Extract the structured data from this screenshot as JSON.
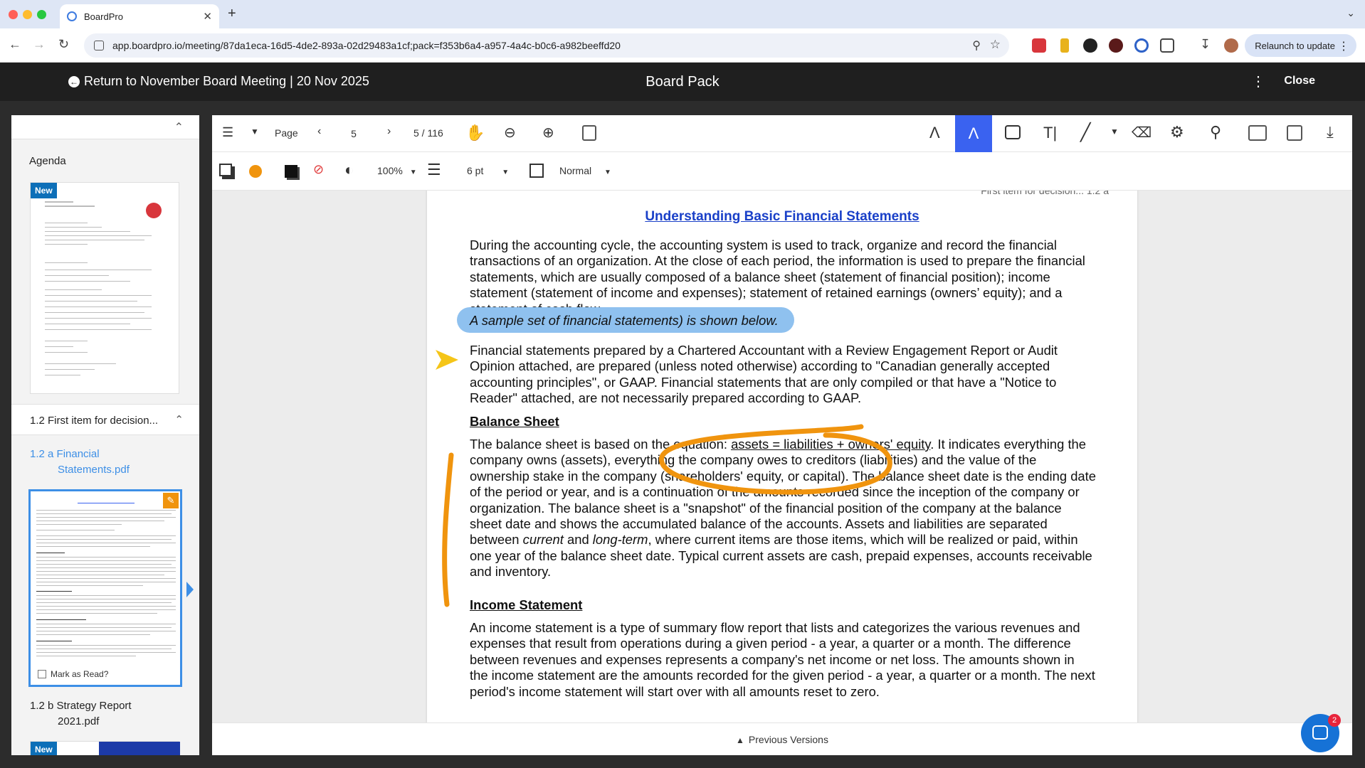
{
  "browser": {
    "tab_title": "BoardPro",
    "new_tab": "+",
    "tab_close": "✕",
    "tab_dropdown": "⌄",
    "url": "app.boardpro.io/meeting/87da1eca-16d5-4de2-893a-02d29483a1cf;pack=f353b6a4-a957-4a4c-b0c6-a982beeffd20",
    "relaunch_label": "Relaunch to update"
  },
  "header": {
    "back_label": "Return to November Board Meeting | 20 Nov 2025",
    "title": "Board Pack",
    "close_label": "Close"
  },
  "sidebar": {
    "agenda_label": "Agenda",
    "new_badge": "New",
    "section_label": "1.2 First item for decision...",
    "files": [
      {
        "label_line1": "1.2 a Financial",
        "label_line2": "Statements.pdf",
        "active": true
      },
      {
        "label_line1": "1.2 b Strategy Report",
        "label_line2": "2021.pdf",
        "active": false
      }
    ],
    "mark_as_read": "Mark as Read?"
  },
  "toolbar": {
    "page_label": "Page",
    "page_value": "5",
    "page_total": "5 / 116",
    "zoom_value": "100%",
    "stroke_value": "6 pt",
    "blend_value": "Normal"
  },
  "document": {
    "header_text": "First item for decision... 1.2 a",
    "title": "Understanding Basic Financial Statements",
    "p1": "During the accounting cycle, the accounting system is used to track, organize and record the financial transactions of an organization. At the close of each period, the information is used to prepare the financial statements, which are usually composed of a balance sheet (statement of financial position); income statement (statement of income and expenses); statement of retained earnings (owners’ equity); and a statement of cash flow.",
    "p2": "A sample set of financial statements) is shown below.",
    "p3": "Financial statements prepared by a Chartered Accountant with a Review Engagement Report or Audit Opinion attached, are prepared (unless noted otherwise) according to \"Canadian generally accepted accounting principles\", or GAAP. Financial statements that are only compiled or that have a \"Notice to Reader\" attached, are not necessarily prepared according to GAAP.",
    "h_balance": "Balance Sheet",
    "p4_a": "The balance sheet is based on the equation: ",
    "p4_eq": "assets = liabilities + owners' equity",
    "p4_b": ". It indicates everything the company owns (assets), everything the company owes to creditors (liabilities) and the value of the ownership stake in the company (shareholders' equity, or capital). The balance sheet date is the ending date of the period or year, and is a continuation of the amounts recorded since the inception of the company or organization. The balance sheet is a \"snapshot\" of the financial position of the company at the balance sheet date and shows the accumulated balance of the accounts. Assets and liabilities are separated between ",
    "p4_cur": "current",
    "p4_and": " and ",
    "p4_lt": "long-term",
    "p4_c": ", where current items are those items, which will be realized or paid, within one year of the balance sheet date. Typical current assets are cash, prepaid expenses, accounts receivable and inventory.",
    "h_income": "Income Statement",
    "p5": "An income statement is a type of summary flow report that lists and categorizes the various revenues and expenses that result from operations during a given period - a year, a quarter or a month. The difference between revenues and expenses represents a company's net income or net loss. The amounts shown in the income statement are the amounts recorded for the given period - a year, a quarter or a month. The next period's income statement will start over with all amounts reset to zero."
  },
  "footer": {
    "previous_versions": "Previous Versions"
  },
  "chat": {
    "badge_count": "2"
  },
  "colors": {
    "accent": "#3a62f0",
    "highlight": "#8fc1ef",
    "ink_orange": "#f0940e",
    "arrow_yellow": "#f5c518",
    "title_link": "#1a40c8"
  }
}
